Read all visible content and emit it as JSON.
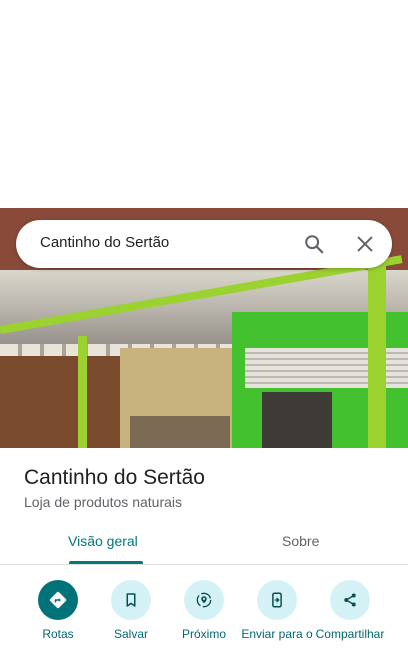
{
  "search": {
    "query": "Cantinho do Sertão"
  },
  "place": {
    "name": "Cantinho do Sertão",
    "category": "Loja de produtos naturais"
  },
  "tabs": [
    {
      "label": "Visão geral",
      "selected": true
    },
    {
      "label": "Sobre",
      "selected": false
    }
  ],
  "actions": [
    {
      "label": "Rotas",
      "icon": "directions-icon"
    },
    {
      "label": "Salvar",
      "icon": "bookmark-icon"
    },
    {
      "label": "Próximo",
      "icon": "nearby-icon"
    },
    {
      "label": "Enviar para o",
      "icon": "send-to-phone-icon"
    },
    {
      "label": "Compartilhar",
      "icon": "share-icon"
    }
  ],
  "colors": {
    "accent": "#00797c",
    "action_bg": "#d4f1f5",
    "primary_action_bg": "#00737a"
  }
}
